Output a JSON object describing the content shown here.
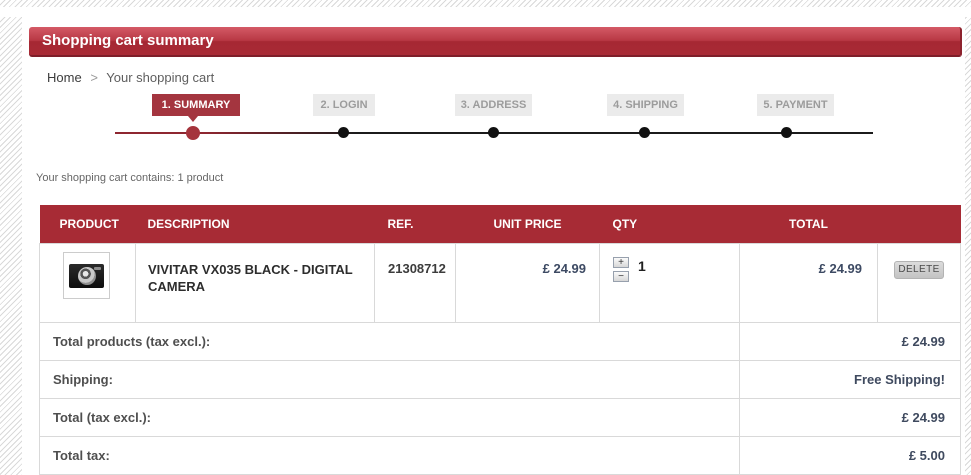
{
  "window": {
    "title": "Shopping cart summary"
  },
  "breadcrumb": {
    "home": "Home",
    "separator": ">",
    "current": "Your shopping cart"
  },
  "steps": {
    "items": [
      {
        "label": "1. SUMMARY",
        "active": true
      },
      {
        "label": "2. LOGIN",
        "active": false
      },
      {
        "label": "3. ADDRESS",
        "active": false
      },
      {
        "label": "4. SHIPPING",
        "active": false
      },
      {
        "label": "5. PAYMENT",
        "active": false
      }
    ]
  },
  "cart": {
    "contains_text": "Your shopping cart contains: 1 product"
  },
  "table": {
    "headers": [
      "PRODUCT",
      "DESCRIPTION",
      "REF.",
      "UNIT PRICE",
      "QTY",
      "TOTAL",
      ""
    ],
    "row": {
      "description": "VIVITAR VX035 BLACK - DIGITAL CAMERA",
      "ref": "21308712",
      "unit_price": "£ 24.99",
      "qty": "1",
      "qty_increase": "+",
      "qty_decrease": "−",
      "total": "£ 24.99",
      "delete_label": "DELETE"
    }
  },
  "totals": {
    "rows": [
      {
        "label": "Total products (tax excl.):",
        "value": "£ 24.99"
      },
      {
        "label": "Shipping:",
        "value": "Free Shipping!"
      },
      {
        "label": "Total (tax excl.):",
        "value": "£ 24.99"
      },
      {
        "label": "Total tax:",
        "value": "£ 5.00"
      }
    ]
  },
  "colors": {
    "accent_red": "#a72b35",
    "step_active": "#a4353f",
    "price_text": "#3d4a63"
  }
}
